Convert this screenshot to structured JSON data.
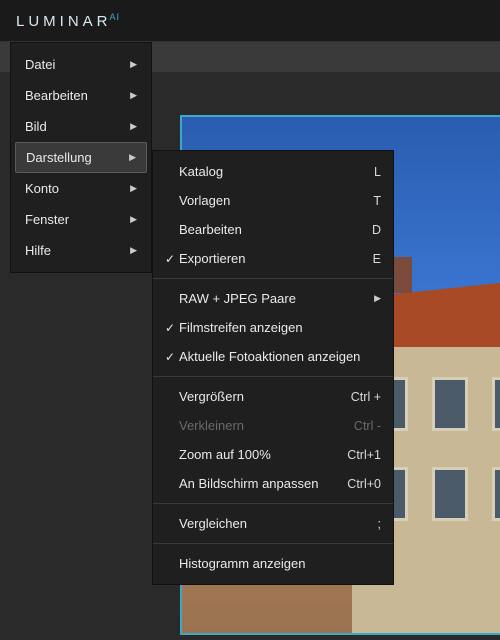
{
  "app": {
    "logo_main": "LUMINAR",
    "logo_suffix": "AI"
  },
  "main_menu": {
    "items": [
      {
        "label": "Datei",
        "has_sub": true
      },
      {
        "label": "Bearbeiten",
        "has_sub": true
      },
      {
        "label": "Bild",
        "has_sub": true
      },
      {
        "label": "Darstellung",
        "has_sub": true,
        "highlight": true
      },
      {
        "label": "Konto",
        "has_sub": true
      },
      {
        "label": "Fenster",
        "has_sub": true
      },
      {
        "label": "Hilfe",
        "has_sub": true
      }
    ]
  },
  "submenu": {
    "groups": [
      [
        {
          "label": "Katalog",
          "accel": "L"
        },
        {
          "label": "Vorlagen",
          "accel": "T"
        },
        {
          "label": "Bearbeiten",
          "accel": "D"
        },
        {
          "label": "Exportieren",
          "accel": "E",
          "checked": true
        }
      ],
      [
        {
          "label": "RAW + JPEG Paare",
          "has_sub": true
        },
        {
          "label": "Filmstreifen anzeigen",
          "checked": true
        },
        {
          "label": "Aktuelle Fotoaktionen anzeigen",
          "checked": true
        }
      ],
      [
        {
          "label": "Vergrößern",
          "accel": "Ctrl +"
        },
        {
          "label": "Verkleinern",
          "accel": "Ctrl -",
          "disabled": true
        },
        {
          "label": "Zoom auf 100%",
          "accel": "Ctrl+1"
        },
        {
          "label": "An Bildschirm anpassen",
          "accel": "Ctrl+0"
        }
      ],
      [
        {
          "label": "Vergleichen",
          "accel": ";"
        }
      ],
      [
        {
          "label": "Histogramm anzeigen"
        }
      ]
    ]
  }
}
